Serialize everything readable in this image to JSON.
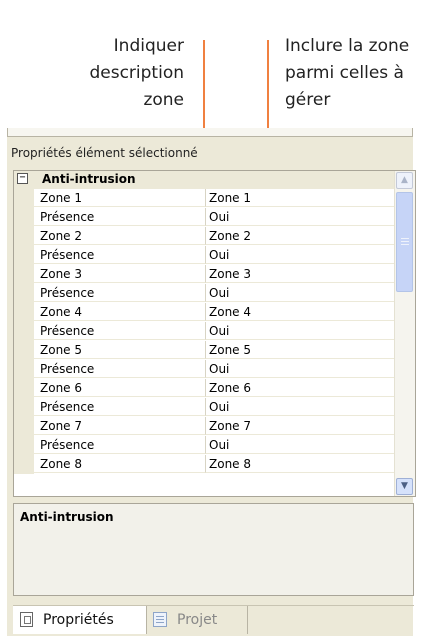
{
  "annotations": {
    "left_callout": [
      "Indiquer",
      "description",
      "zone"
    ],
    "right_callout": [
      "Inclure la zone",
      "parmi celles à",
      "gérer"
    ],
    "leader_color": "#f08040"
  },
  "panel": {
    "title": "Propriétés élément sélectionné"
  },
  "grid": {
    "category": {
      "toggle": "−",
      "label": "Anti-intrusion"
    },
    "rows": [
      {
        "name": "Zone 1",
        "value": "Zone 1"
      },
      {
        "name": "Présence",
        "value": "Oui"
      },
      {
        "name": "Zone 2",
        "value": "Zone 2"
      },
      {
        "name": "Présence",
        "value": "Oui"
      },
      {
        "name": "Zone 3",
        "value": "Zone 3"
      },
      {
        "name": "Présence",
        "value": "Oui"
      },
      {
        "name": "Zone 4",
        "value": "Zone 4"
      },
      {
        "name": "Présence",
        "value": "Oui"
      },
      {
        "name": "Zone 5",
        "value": "Zone 5"
      },
      {
        "name": "Présence",
        "value": "Oui"
      },
      {
        "name": "Zone 6",
        "value": "Zone 6"
      },
      {
        "name": "Présence",
        "value": "Oui"
      },
      {
        "name": "Zone 7",
        "value": "Zone 7"
      },
      {
        "name": "Présence",
        "value": "Oui"
      },
      {
        "name": "Zone 8",
        "value": "Zone 8"
      }
    ],
    "scrollbar": {
      "up_glyph": "▲",
      "down_glyph": "▼"
    }
  },
  "description": {
    "title": "Anti-intrusion"
  },
  "tabs": [
    {
      "label": "Propriétés",
      "icon": "properties-icon",
      "active": true
    },
    {
      "label": "Projet",
      "icon": "project-icon",
      "active": false
    }
  ]
}
